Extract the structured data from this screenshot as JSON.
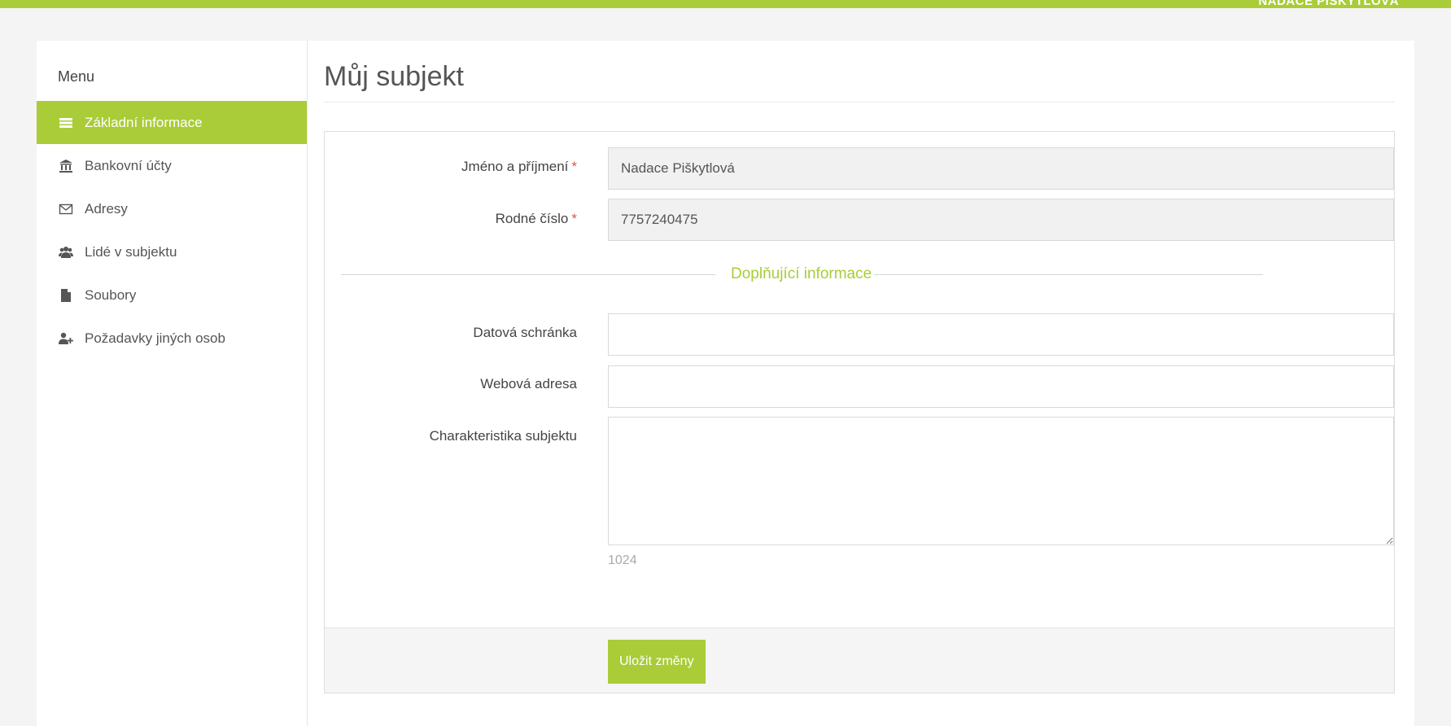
{
  "topbar": {
    "user_name": "NADACE PIŠKYTLOVÁ",
    "color": "#a9cc38"
  },
  "sidebar": {
    "title": "Menu",
    "items": [
      {
        "label": "Základní informace",
        "icon": "list-icon",
        "active": true
      },
      {
        "label": "Bankovní účty",
        "icon": "bank-icon",
        "active": false
      },
      {
        "label": "Adresy",
        "icon": "envelope-icon",
        "active": false
      },
      {
        "label": "Lidé v subjektu",
        "icon": "users-icon",
        "active": false
      },
      {
        "label": "Soubory",
        "icon": "file-icon",
        "active": false
      },
      {
        "label": "Požadavky jiných osob",
        "icon": "user-plus-icon",
        "active": false
      }
    ]
  },
  "main": {
    "title": "Můj subjekt",
    "fields": {
      "name": {
        "label": "Jméno a příjmení",
        "required_mark": "*",
        "value": "Nadace Piškytlová"
      },
      "birth_number": {
        "label": "Rodné číslo",
        "required_mark": "*",
        "value": "7757240475"
      }
    },
    "section_title": "Doplňující informace",
    "extra_fields": {
      "data_box": {
        "label": "Datová schránka",
        "value": ""
      },
      "website": {
        "label": "Webová adresa",
        "value": ""
      },
      "characteristics": {
        "label": "Charakteristika subjektu",
        "value": "",
        "counter": "1024"
      }
    },
    "save_label": "Uložit změny"
  }
}
